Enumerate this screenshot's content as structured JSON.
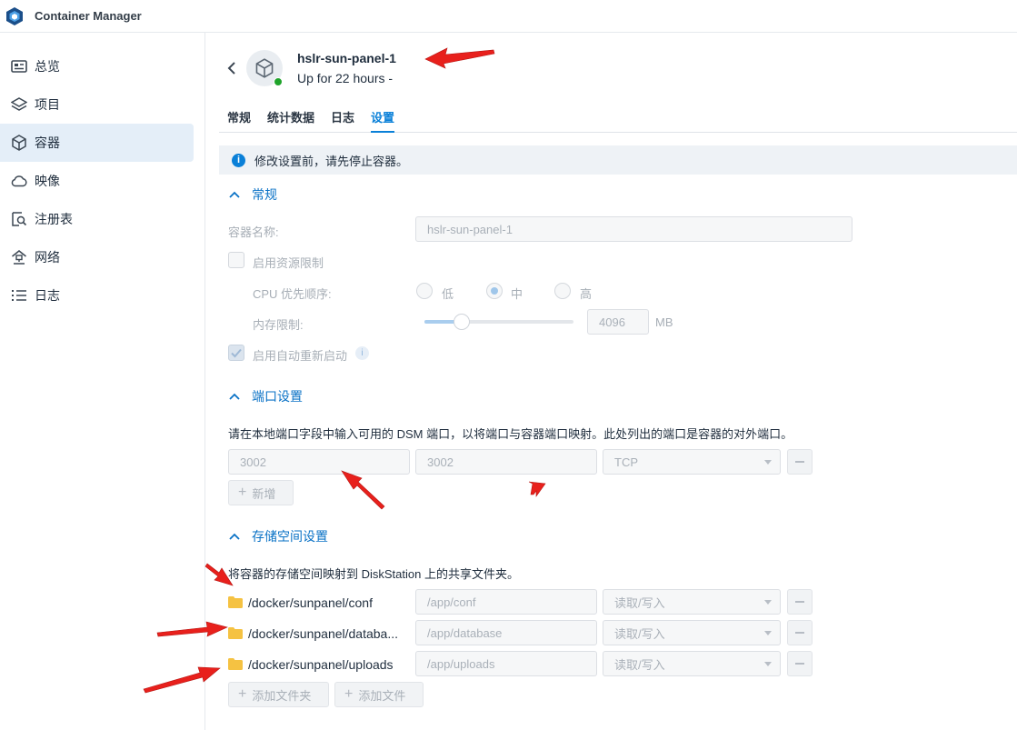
{
  "app": {
    "title": "Container Manager"
  },
  "sidebar": {
    "items": [
      {
        "label": "总览",
        "icon": "overview-icon"
      },
      {
        "label": "项目",
        "icon": "layers-icon"
      },
      {
        "label": "容器",
        "icon": "cube-icon",
        "active": true
      },
      {
        "label": "映像",
        "icon": "cloud-icon"
      },
      {
        "label": "注册表",
        "icon": "registry-search-icon"
      },
      {
        "label": "网络",
        "icon": "network-icon"
      },
      {
        "label": "日志",
        "icon": "list-icon"
      }
    ]
  },
  "header": {
    "container_name": "hslr-sun-panel-1",
    "status_text": "Up for 22 hours -"
  },
  "tabs": [
    {
      "label": "常规"
    },
    {
      "label": "统计数据"
    },
    {
      "label": "日志"
    },
    {
      "label": "设置",
      "active": true
    }
  ],
  "info_bar": {
    "text": "修改设置前，请先停止容器。"
  },
  "general": {
    "title": "常规",
    "name_label": "容器名称:",
    "name_value": "hslr-sun-panel-1",
    "resource_limit_label": "启用资源限制",
    "cpu_label": "CPU 优先顺序:",
    "cpu_options": [
      "低",
      "中",
      "高"
    ],
    "cpu_selected": "中",
    "memory_label": "内存限制:",
    "memory_value": "4096",
    "memory_unit": "MB",
    "memory_slider_level": 0.25,
    "auto_restart_label": "启用自动重新启动",
    "auto_restart_checked": true
  },
  "ports": {
    "title": "端口设置",
    "description": "请在本地端口字段中输入可用的 DSM 端口，以将端口与容器端口映射。此处列出的端口是容器的对外端口。",
    "rows": [
      {
        "local": "3002",
        "container": "3002",
        "protocol": "TCP"
      }
    ],
    "add_label": "新增"
  },
  "storage": {
    "title": "存储空间设置",
    "description": "将容器的存储空间映射到 DiskStation 上的共享文件夹。",
    "rows": [
      {
        "host": "/docker/sunpanel/conf",
        "mount": "/app/conf",
        "mode": "读取/写入"
      },
      {
        "host": "/docker/sunpanel/databa...",
        "mount": "/app/database",
        "mode": "读取/写入"
      },
      {
        "host": "/docker/sunpanel/uploads",
        "mount": "/app/uploads",
        "mode": "读取/写入"
      }
    ],
    "add_folder_label": "添加文件夹",
    "add_file_label": "添加文件"
  },
  "colors": {
    "accent": "#0a80d8",
    "status_running": "#1fa32a",
    "annotation_arrow": "#e8201c",
    "folder": "#f5c242"
  }
}
